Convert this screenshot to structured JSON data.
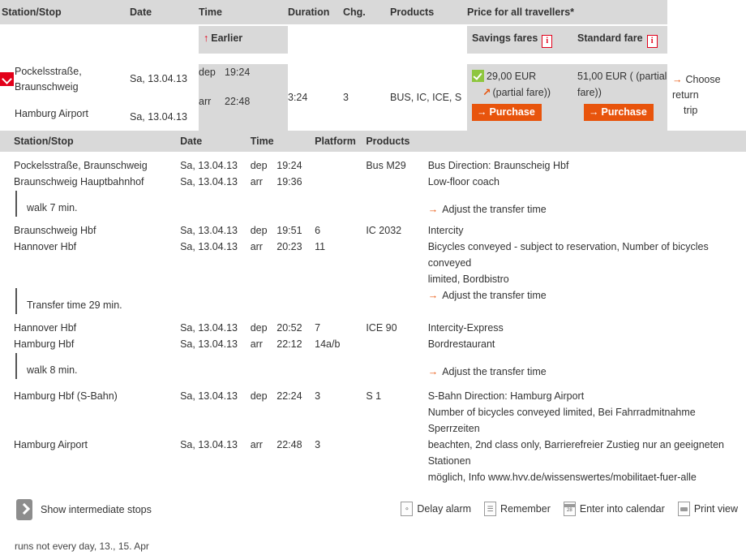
{
  "results_table": {
    "headers": [
      {
        "label": "Station/Stop",
        "name": "header-station-stop"
      },
      {
        "label": "Date",
        "name": "header-date"
      },
      {
        "label": "Time",
        "name": "header-time"
      },
      {
        "label": "Duration",
        "name": "header-duration"
      },
      {
        "label": "Chg.",
        "name": "header-changes"
      },
      {
        "label": "Products",
        "name": "header-products"
      },
      {
        "label": "Price for all travellers*",
        "name": "header-price"
      }
    ],
    "subheader": {
      "earlier_label": "Earlier",
      "earlier_icon": "up-arrow-icon",
      "savings_fares_label": "Savings fares",
      "standard_fare_label": "Standard fare",
      "info_icon": "info-icon",
      "info_glyph": "i"
    },
    "row": {
      "selected_icon": "chevron-down-marker-icon",
      "origin": "Pockelsstraße, Braunschweig",
      "destination": "Hamburg Airport",
      "date_dep": "Sa, 13.04.13",
      "date_arr": "Sa, 13.04.13",
      "dep_label": "dep",
      "dep_time": "19:24",
      "arr_label": "arr",
      "arr_time": "22:48",
      "duration": "3:24",
      "changes": "3",
      "products": "BUS, IC, ICE, S",
      "savings": {
        "check_icon": "green-check-icon",
        "price": "29,00 EUR",
        "partial_icon": "small-arrow-icon",
        "partial_note": "(partial fare))",
        "purchase_label": "Purchase",
        "purchase_arrow": "→"
      },
      "standard": {
        "price": "51,00 EUR  (  (partial fare))",
        "price_line1": "51,00 EUR  (  (partial",
        "price_line2": "fare))",
        "purchase_label": "Purchase",
        "purchase_arrow": "→"
      },
      "return_link": {
        "arrow": "→",
        "line1": "Choose return",
        "line2": "trip"
      }
    }
  },
  "detail_table": {
    "headers": {
      "station": "Station/Stop",
      "date": "Date",
      "time": "Time",
      "platform": "Platform",
      "products": "Products"
    },
    "legs": [
      {
        "dep_station": "Pockelsstraße, Braunschweig",
        "dep_date": "Sa, 13.04.13",
        "dep_label": "dep",
        "dep_time": "19:24",
        "dep_platform": "",
        "arr_station": "Braunschweig Hauptbahnhof",
        "arr_date": "Sa, 13.04.13",
        "arr_label": "arr",
        "arr_time": "19:36",
        "arr_platform": "",
        "product": "Bus M29",
        "info_line1": "Bus Direction: Braunscheig Hbf",
        "info_line2": "Low-floor coach",
        "info_line3": "",
        "adjust_label": "Adjust the transfer time"
      },
      {
        "dep_station": "Braunschweig Hbf",
        "dep_date": "Sa, 13.04.13",
        "dep_label": "dep",
        "dep_time": "19:51",
        "dep_platform": "6",
        "arr_station": "Hannover Hbf",
        "arr_date": "Sa, 13.04.13",
        "arr_label": "arr",
        "arr_time": "20:23",
        "arr_platform": "11",
        "product": "IC 2032",
        "info_line1": "Intercity",
        "info_line2": "Bicycles conveyed - subject to reservation, Number of bicycles conveyed",
        "info_line3": "limited, Bordbistro",
        "adjust_label": "Adjust the transfer time"
      },
      {
        "dep_station": "Hannover Hbf",
        "dep_date": "Sa, 13.04.13",
        "dep_label": "dep",
        "dep_time": "20:52",
        "dep_platform": "7",
        "arr_station": "Hamburg Hbf",
        "arr_date": "Sa, 13.04.13",
        "arr_label": "arr",
        "arr_time": "22:12",
        "arr_platform": "14a/b",
        "product": "ICE 90",
        "info_line1": "Intercity-Express",
        "info_line2": "Bordrestaurant",
        "info_line3": "",
        "adjust_label": "Adjust the transfer time"
      },
      {
        "dep_station": "Hamburg Hbf (S-Bahn)",
        "dep_date": "Sa, 13.04.13",
        "dep_label": "dep",
        "dep_time": "22:24",
        "dep_platform": "3",
        "arr_station": "Hamburg Airport",
        "arr_date": "Sa, 13.04.13",
        "arr_label": "arr",
        "arr_time": "22:48",
        "arr_platform": "3",
        "product": "S 1",
        "info_line1": "S-Bahn Direction: Hamburg Airport",
        "info_line2": "Number of bicycles conveyed limited, Bei Fahrradmitnahme Sperrzeiten",
        "info_line3": "beachten, 2nd class only, Barrierefreier Zustieg nur an geeigneten Stationen",
        "info_line4": "möglich, Info www.hvv.de/wissenswertes/mobilitaet-fuer-alle",
        "adjust_label": ""
      }
    ],
    "breaks": [
      {
        "label": "walk  7 min.",
        "name": "walk-break-1"
      },
      {
        "label": "Transfer time 29 min.",
        "name": "transfer-break-1"
      },
      {
        "label": "walk  8 min.",
        "name": "walk-break-2"
      }
    ]
  },
  "footer": {
    "show_stops": {
      "icon": "chevron-right-icon",
      "label": "Show intermediate stops"
    },
    "actions": [
      {
        "label": "Delay alarm",
        "icon": "delay-alarm-icon",
        "glyph": "◎"
      },
      {
        "label": "Remember",
        "icon": "remember-icon",
        "glyph": "▤"
      },
      {
        "label": "Enter into calendar",
        "icon": "calendar-icon",
        "glyph": "28"
      },
      {
        "label": "Print view",
        "icon": "printer-icon",
        "glyph": ""
      }
    ],
    "note": "runs not every day, 13., 15. Apr"
  },
  "colors": {
    "accent_red": "#e2001a",
    "accent_orange": "#e8540c",
    "header_gray": "#d9d9d9",
    "green": "#8ec63f"
  }
}
